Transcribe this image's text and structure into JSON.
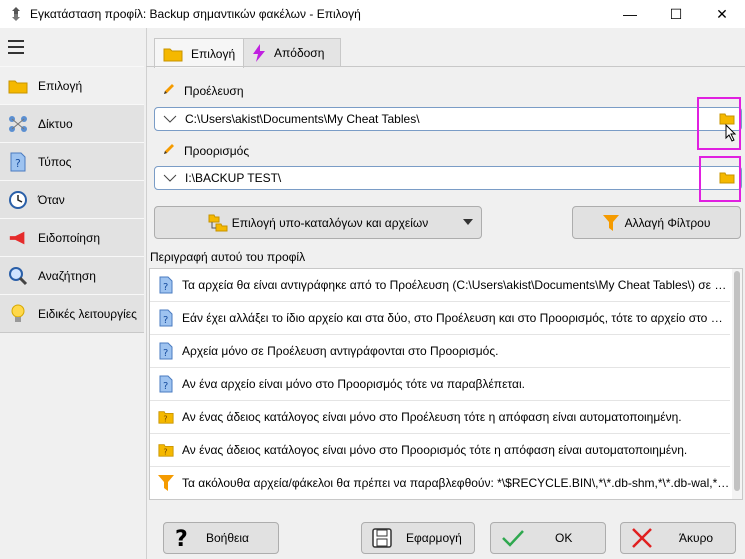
{
  "window": {
    "title": "Εγκατάσταση προφίλ: Backup σημαντικών φακέλων - Επιλογή",
    "minimize_glyph": "—",
    "maximize_glyph": "☐",
    "close_glyph": "✕"
  },
  "sidebar": {
    "items": [
      {
        "label": "Επιλογή",
        "icon": "folder-icon"
      },
      {
        "label": "Δίκτυο",
        "icon": "network-icon"
      },
      {
        "label": "Τύπος",
        "icon": "document-question-icon"
      },
      {
        "label": "Όταν",
        "icon": "clock-icon"
      },
      {
        "label": "Ειδοποίηση",
        "icon": "megaphone-icon"
      },
      {
        "label": "Αναζήτηση",
        "icon": "magnifier-icon"
      },
      {
        "label": "Ειδικές λειτουργίες",
        "icon": "lightbulb-icon"
      }
    ],
    "active_index": 0
  },
  "tabs": [
    {
      "label": "Επιλογή",
      "icon": "folder-icon"
    },
    {
      "label": "Απόδοση",
      "icon": "lightning-icon"
    }
  ],
  "source": {
    "label": "Προέλευση",
    "value": "C:\\Users\\akist\\Documents\\My Cheat Tables\\"
  },
  "destination": {
    "label": "Προορισμός",
    "value": "I:\\BACKUP TEST\\"
  },
  "buttons": {
    "select_subfolders": "Επιλογή υπο-καταλόγων και αρχείων",
    "change_filter": "Αλλαγή Φίλτρου"
  },
  "description": {
    "label": "Περιγραφή αυτού του προφίλ",
    "rows": [
      {
        "icon": "document-question-icon",
        "text": "Τα αρχεία θα είναι αντιγράφηκε από το Προέλευση (C:\\Users\\akist\\Documents\\My Cheat Tables\\) σε Προορισμός"
      },
      {
        "icon": "document-question-icon",
        "text": "Εάν έχει αλλάξει το ίδιο αρχείο και στα δύο, στο Προέλευση και στο Προορισμός, τότε το αρχείο στο Προέλευση"
      },
      {
        "icon": "document-question-icon",
        "text": "Αρχεία μόνο σε Προέλευση αντιγράφονται στο Προορισμός."
      },
      {
        "icon": "document-question-icon",
        "text": "Αν ένα αρχείο είναι μόνο στο Προορισμός τότε να παραβλέπεται."
      },
      {
        "icon": "folder-question-icon",
        "text": "Αν ένας άδειος κατάλογος είναι μόνο στο Προέλευση τότε η απόφαση είναι αυτοματοποιημένη."
      },
      {
        "icon": "folder-question-icon",
        "text": "Αν ένας άδειος κατάλογος είναι μόνο στο Προορισμός τότε η απόφαση είναι αυτοματοποιημένη."
      },
      {
        "icon": "filter-icon",
        "text": "Τα ακόλουθα αρχεία/φάκελοι θα πρέπει να παραβλεφθούν: *\\$RECYCLE.BIN\\,*\\*.db-shm,*\\*.db-wal,*\\*.SBAK"
      }
    ]
  },
  "footer": {
    "help": "Βοήθεια",
    "apply": "Εφαρμογή",
    "ok": "OK",
    "cancel": "Άκυρο"
  },
  "colors": {
    "highlight_box": "#e020e0",
    "folder": "#f5b800",
    "accent_border": "#7a9cc6"
  }
}
